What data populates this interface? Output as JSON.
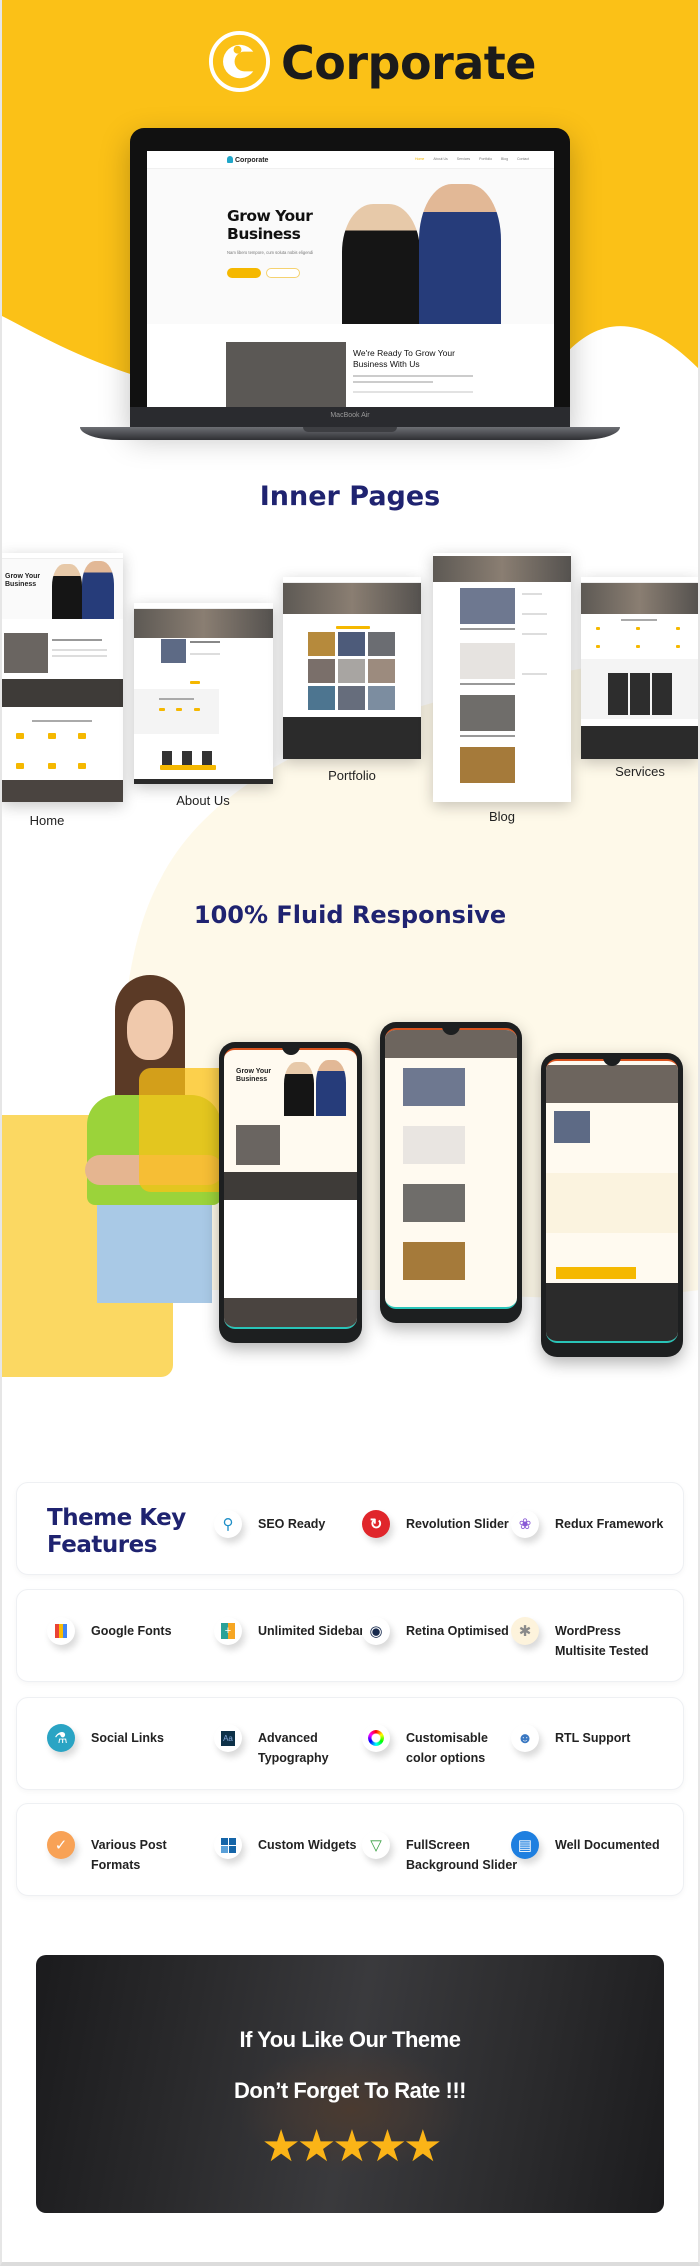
{
  "brand": {
    "name": "Corporate",
    "accent": "#fbc117",
    "navy": "#1f2370"
  },
  "laptop": {
    "model_label": "MacBook Air",
    "nav": {
      "logo": "Corporate",
      "items": [
        "Home",
        "About Us",
        "Services",
        "Portfolio",
        "Blog",
        "Contact"
      ]
    },
    "hero": {
      "title": "Grow Your Business",
      "subtitle": "Nam libero tempore, cum soluta nobis eligendi"
    },
    "section": {
      "title": "We're Ready To Grow Your Business With Us"
    }
  },
  "inner_pages": {
    "title": "Inner Pages",
    "pages": [
      {
        "label": "Home"
      },
      {
        "label": "About Us"
      },
      {
        "label": "Portfolio"
      },
      {
        "label": "Blog"
      },
      {
        "label": "Services"
      }
    ]
  },
  "responsive": {
    "title": "100% Fluid Responsive"
  },
  "features": {
    "title": "Theme Key Features",
    "rows": [
      [
        {
          "label": "SEO Ready",
          "icon": "seo-magnifier-icon"
        },
        {
          "label": "Revolution Slider",
          "icon": "revolution-slider-icon"
        },
        {
          "label": "Redux Framework",
          "icon": "redux-icon"
        }
      ],
      [
        {
          "label": "Google Fonts",
          "icon": "google-fonts-icon"
        },
        {
          "label": "Unlimited Sidebars",
          "icon": "sidebars-icon"
        },
        {
          "label": "Retina Optimised",
          "icon": "eye-icon"
        },
        {
          "label": "WordPress Multisite Tested",
          "icon": "network-icon"
        }
      ],
      [
        {
          "label": "Social Links",
          "icon": "social-icon"
        },
        {
          "label": "Advanced Typography",
          "icon": "typography-icon"
        },
        {
          "label": "Customisable color options",
          "icon": "color-wheel-icon"
        },
        {
          "label": "RTL Support",
          "icon": "support-agent-icon"
        }
      ],
      [
        {
          "label": "Various Post Formats",
          "icon": "post-format-icon"
        },
        {
          "label": "Custom Widgets",
          "icon": "widgets-icon"
        },
        {
          "label": "FullScreen Background Slider",
          "icon": "slider-icon"
        },
        {
          "label": "Well Documented",
          "icon": "document-icon"
        }
      ]
    ]
  },
  "rate": {
    "line1": "If You Like Our Theme",
    "line2": "Don’t Forget To Rate !!!",
    "stars": 5,
    "star_color": "#fbb417"
  }
}
